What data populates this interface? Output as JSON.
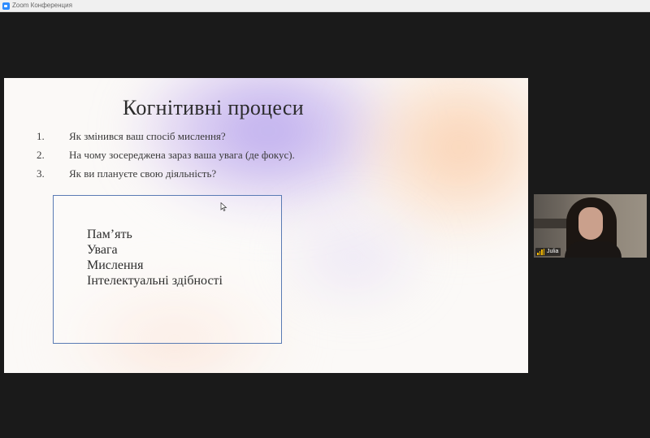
{
  "window": {
    "title": "Zoom Конференция"
  },
  "slide": {
    "title": "Когнітивні процеси",
    "questions": [
      {
        "num": "1.",
        "text": "Як змінився ваш спосіб мислення?"
      },
      {
        "num": "2.",
        "text": "На чому зосереджена зараз ваша увага (де фокус)."
      },
      {
        "num": "3.",
        "text": "Як ви плануєте свою діяльність?"
      }
    ],
    "terms": [
      "Пам’ять",
      "Увага",
      "Мислення",
      "Інтелектуальні здібності"
    ]
  },
  "participant": {
    "name": "Julia",
    "signal_color": "#f5b900"
  },
  "icons": {
    "app": "zoom-app-icon",
    "cursor": "mouse-pointer-icon",
    "signal": "connection-signal-icon"
  }
}
